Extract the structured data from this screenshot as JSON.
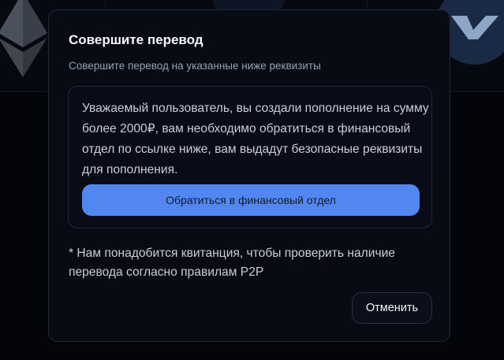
{
  "dialog": {
    "title": "Совершите перевод",
    "subtitle": "Совершите перевод на указанные ниже реквизиты",
    "info": {
      "message": "Уважаемый пользователь, вы создали пополнение на сумму более 2000₽, вам необходимо обратиться в финансовый отдел по ссылке ниже, вам выдадут безопасные реквизиты для пополнения.",
      "button_label": "Обратиться в финансовый отдел"
    },
    "footnote": "* Нам понадобится квитанция, чтобы проверить наличие перевода согласно правилам P2P",
    "cancel_label": "Отменить"
  },
  "background": {
    "icons": [
      "ethereum-icon",
      "coin-icon",
      "check-logo-icon"
    ]
  },
  "colors": {
    "accent": "#5287f2",
    "modal_bg": "#070b14",
    "border": "#222838",
    "text_primary": "#f5f7fa",
    "text_secondary": "#98a0ad"
  }
}
